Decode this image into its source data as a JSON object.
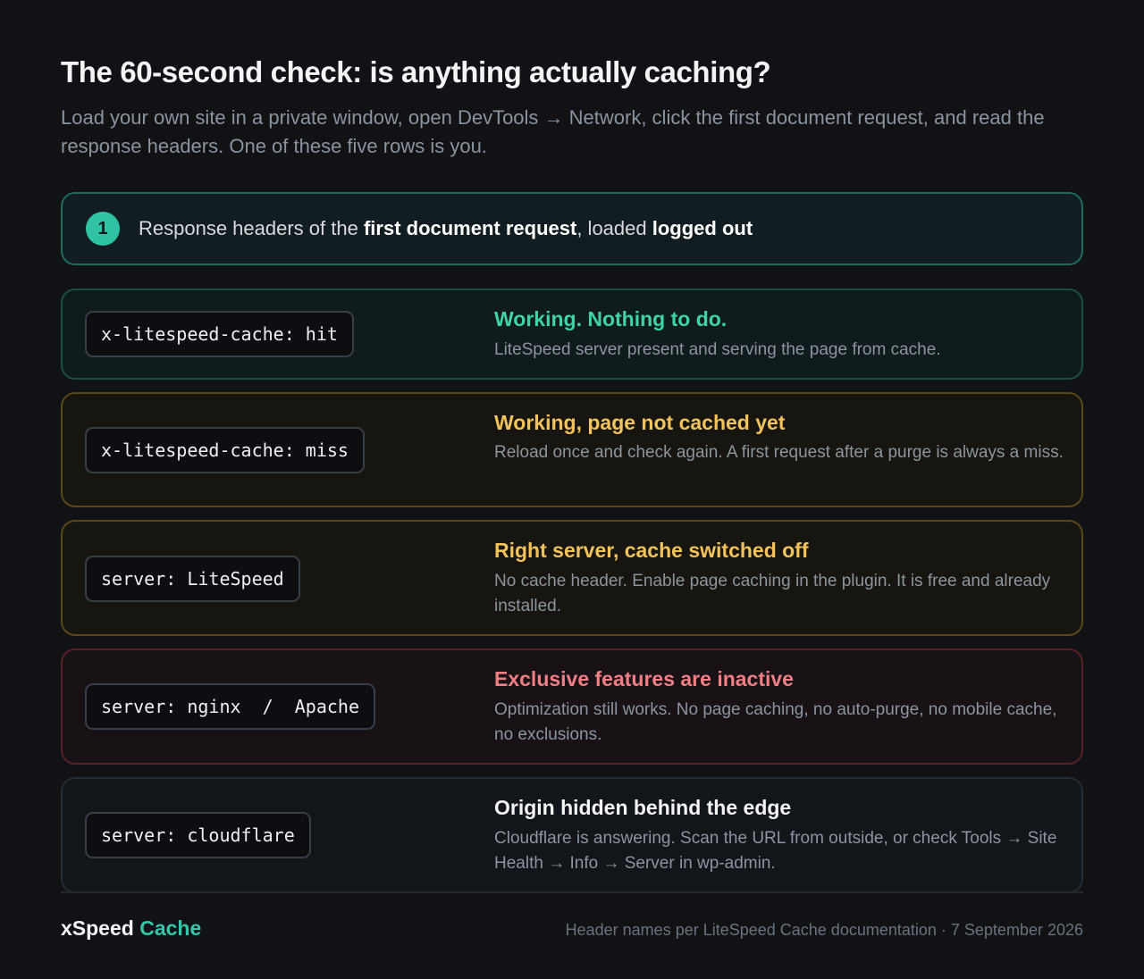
{
  "title": "The 60-second check: is anything actually caching?",
  "subtitle": "Load your own site in a private window, open DevTools → Network, click the first document request, and read the response headers. One of these five rows is you.",
  "step": {
    "number": "1",
    "text_1": "Response headers of the ",
    "bold_1": "first document request",
    "text_2": ", loaded ",
    "bold_2": "logged out"
  },
  "rows": [
    {
      "header": "x-litespeed-cache: hit",
      "heading": "Working. Nothing to do.",
      "description": "LiteSpeed server present and serving the page from cache.",
      "heading_color": "#3fd3a6"
    },
    {
      "header": "x-litespeed-cache: miss",
      "heading": "Working, page not cached yet",
      "description": "Reload once and check again. A first request after a purge is always a miss.",
      "heading_color": "#f2c25b"
    },
    {
      "header": "server: LiteSpeed",
      "heading": "Right server, cache switched off",
      "description": "No cache header. Enable page caching in the plugin. It is free and already installed.",
      "heading_color": "#f2c25b"
    },
    {
      "header": "server: nginx  /  Apache",
      "heading": "Exclusive features are inactive",
      "description": "Optimization still works. No page caching, no auto-purge, no mobile cache, no exclusions.",
      "heading_color": "#f07f83"
    },
    {
      "header": "server: cloudflare",
      "heading": "Origin hidden behind the edge",
      "description": "Cloudflare is answering. Scan the URL from outside, or check Tools → Site Health → Info → Server in wp-admin.",
      "heading_color": "#f3f4f6"
    }
  ],
  "footer": {
    "brand_1": "xSpeed",
    "brand_2": "Cache",
    "note": "Header names per LiteSpeed Cache documentation · 7 September 2026"
  }
}
